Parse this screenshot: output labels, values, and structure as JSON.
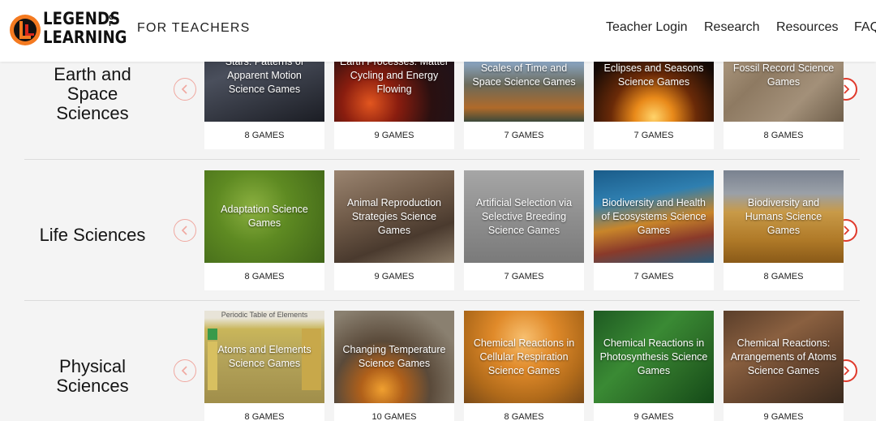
{
  "header": {
    "logo": {
      "line1": "LEGENDS",
      "of": "OF",
      "line2": "LEARNING",
      "initial": "LL"
    },
    "for_teachers": "FOR TEACHERS",
    "nav": [
      "Teacher Login",
      "Research",
      "Resources",
      "FAQ"
    ]
  },
  "colors": {
    "accent_red": "#e03a2c",
    "logo_orange": "#f47a20",
    "logo_red": "#d9281c"
  },
  "sections": [
    {
      "title_lines": [
        "Earth and",
        "Space",
        "Sciences"
      ],
      "cards": [
        {
          "title": "Stars: Patterns of Apparent Motion Science Games",
          "count": "8 GAMES"
        },
        {
          "title": "Earth Processes: Matter Cycling and Energy Flowing",
          "count": "9 GAMES"
        },
        {
          "title": "Scales of Time and Space Science Games",
          "count": "7 GAMES"
        },
        {
          "title": "Eclipses and Seasons Science Games",
          "count": "7 GAMES"
        },
        {
          "title": "Fossil Record Science Games",
          "count": "8 GAMES"
        }
      ]
    },
    {
      "title_lines": [
        "Life Sciences"
      ],
      "cards": [
        {
          "title": "Adaptation Science Games",
          "count": "8 GAMES"
        },
        {
          "title": "Animal Reproduction Strategies Science Games",
          "count": "9 GAMES"
        },
        {
          "title": "Artificial Selection via Selective Breeding Science Games",
          "count": "7 GAMES"
        },
        {
          "title": "Biodiversity and Health of Ecosystems Science Games",
          "count": "7 GAMES"
        },
        {
          "title": "Biodiversity and Humans Science Games",
          "count": "8 GAMES"
        }
      ]
    },
    {
      "title_lines": [
        "Physical",
        "Sciences"
      ],
      "periodic_label": "Periodic Table of Elements",
      "cards": [
        {
          "title": "Atoms and Elements Science Games",
          "count": "8 GAMES"
        },
        {
          "title": "Changing Temperature Science Games",
          "count": "10 GAMES"
        },
        {
          "title": "Chemical Reactions in Cellular Respiration Science Games",
          "count": "8 GAMES"
        },
        {
          "title": "Chemical Reactions in Photosynthesis Science Games",
          "count": "9 GAMES"
        },
        {
          "title": "Chemical Reactions: Arrangements of Atoms Science Games",
          "count": "9 GAMES"
        }
      ]
    }
  ]
}
